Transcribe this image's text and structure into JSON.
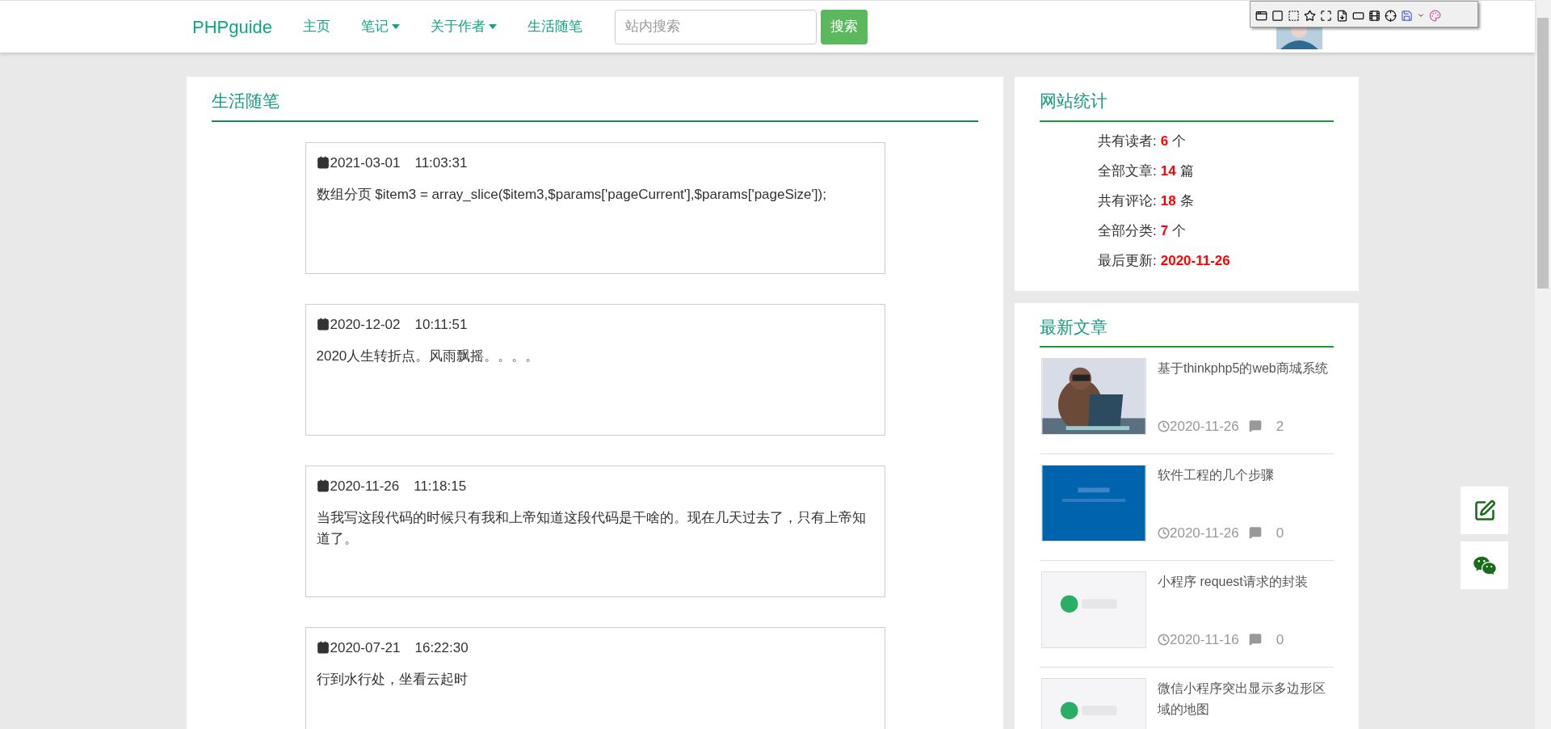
{
  "nav": {
    "brand": "PHPguide",
    "items": [
      {
        "label": "主页",
        "dropdown": false
      },
      {
        "label": "笔记",
        "dropdown": true
      },
      {
        "label": "关于作者",
        "dropdown": true
      },
      {
        "label": "生活随笔",
        "dropdown": false
      }
    ],
    "search": {
      "placeholder": "站内搜索",
      "button": "搜索"
    }
  },
  "main": {
    "title": "生活随笔",
    "posts": [
      {
        "date": "2021-03-01",
        "time": "11:03:31",
        "text": "数组分页 $item3 = array_slice($item3,$params['pageCurrent'],$params['pageSize']);"
      },
      {
        "date": "2020-12-02",
        "time": "10:11:51",
        "text": "2020人生转折点。风雨飘摇。。。。"
      },
      {
        "date": "2020-11-26",
        "time": "11:18:15",
        "text": "当我写这段代码的时候只有我和上帝知道这段代码是干啥的。现在几天过去了，只有上帝知道了。"
      },
      {
        "date": "2020-07-21",
        "time": "16:22:30",
        "text": "行到水行处，坐看云起时"
      }
    ]
  },
  "stats": {
    "title": "网站统计",
    "rows": [
      {
        "label": "共有读者:",
        "value": "6",
        "unit": "个"
      },
      {
        "label": "全部文章:",
        "value": "14",
        "unit": "篇"
      },
      {
        "label": "共有评论:",
        "value": "18",
        "unit": "条"
      },
      {
        "label": "全部分类:",
        "value": "7",
        "unit": "个"
      },
      {
        "label": "最后更新:",
        "value": "2020-11-26"
      }
    ]
  },
  "latest": {
    "title": "最新文章",
    "articles": [
      {
        "title": "基于thinkphp5的web商城系统",
        "date": "2020-11-26",
        "comments": "2"
      },
      {
        "title": "软件工程的几个步骤",
        "date": "2020-11-26",
        "comments": "0"
      },
      {
        "title": "小程序 request请求的封装",
        "date": "2020-11-16",
        "comments": "0"
      },
      {
        "title": "微信小程序突出显示多边形区域的地图"
      }
    ]
  }
}
